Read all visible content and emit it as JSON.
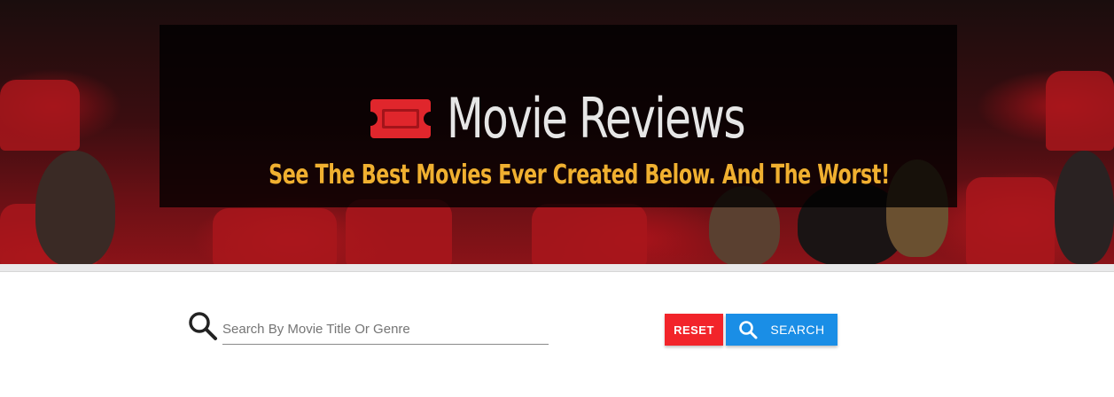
{
  "header": {
    "title": "Movie Reviews",
    "subtitle": "See The Best Movies Ever Created Below. And The Worst!",
    "logo_icon": "ticket-icon"
  },
  "search": {
    "placeholder": "Search By Movie Title Or Genre",
    "value": "",
    "icon": "search-icon"
  },
  "buttons": {
    "reset_label": "RESET",
    "search_label": "SEARCH",
    "search_icon": "search-icon"
  },
  "colors": {
    "accent_yellow": "#f0b030",
    "logo_red": "#e0262c",
    "reset_red": "#f2242a",
    "search_blue": "#1a8ee6"
  }
}
